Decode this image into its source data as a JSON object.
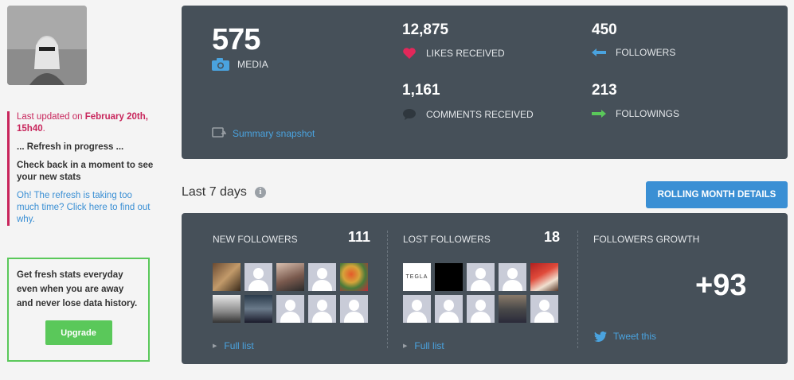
{
  "sidebar": {
    "status": {
      "updated_prefix": "Last updated on ",
      "updated_date": "February 20th, 15h40",
      "updated_suffix": ".",
      "refresh": "... Refresh in progress ...",
      "check_back": "Check back in a moment to see your new stats",
      "refresh_slow_link": "Oh! The refresh is taking too much time? Click here to find out why."
    },
    "promo": {
      "text": "Get fresh stats everyday even when you are away and never lose data history.",
      "upgrade_label": "Upgrade"
    }
  },
  "summary": {
    "media": {
      "value": "575",
      "label": "MEDIA"
    },
    "likes": {
      "value": "12,875",
      "label": "LIKES RECEIVED"
    },
    "comments": {
      "value": "1,161",
      "label": "COMMENTS RECEIVED"
    },
    "followers": {
      "value": "450",
      "label": "FOLLOWERS"
    },
    "followings": {
      "value": "213",
      "label": "FOLLOWINGS"
    },
    "snapshot_link": "Summary snapshot"
  },
  "last7": {
    "title": "Last 7 days",
    "rolling_button": "ROLLING MONTH DETAILS",
    "new_followers": {
      "label": "NEW FOLLOWERS",
      "count": "111",
      "full_list": "Full list"
    },
    "lost_followers": {
      "label": "LOST FOLLOWERS",
      "count": "18",
      "full_list": "Full list",
      "tegla_text": "TEGLA"
    },
    "growth": {
      "label": "FOLLOWERS GROWTH",
      "value": "+93",
      "tweet": "Tweet this"
    }
  },
  "colors": {
    "accent_blue": "#3a8fd4",
    "panel": "#465059",
    "alert": "#c8265c",
    "green": "#5ac85a"
  }
}
